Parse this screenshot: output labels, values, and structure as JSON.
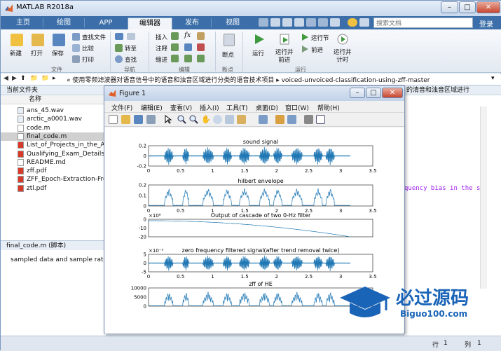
{
  "window": {
    "title": "MATLAB R2018a"
  },
  "tabs": [
    {
      "label": "主页"
    },
    {
      "label": "绘图"
    },
    {
      "label": "APP"
    },
    {
      "label": "编辑器"
    },
    {
      "label": "发布"
    },
    {
      "label": "视图"
    }
  ],
  "search": {
    "placeholder": "搜索文档"
  },
  "login": "登录",
  "ribbon": {
    "new": "新建",
    "open": "打开",
    "save": "保存",
    "find_file": "查找文件",
    "compare": "比较",
    "print": "打印",
    "goto": "转至",
    "find": "查找",
    "insert": "插入",
    "comment": "注释",
    "indent": "缩进",
    "breakpoint": "断点",
    "run": "运行",
    "run_advance": "运行并\n前进",
    "run_section": "运行节",
    "advance": "前进",
    "run_time": "运行并\n计时",
    "groups": {
      "file": "文件",
      "nav": "导航",
      "edit": "编辑",
      "breakpoints": "断点",
      "run": "运行"
    }
  },
  "address": {
    "path": "« 使用零频滤波器对语音信号中的语音和浊音区域进行分类的语音技术项目 ▸ voiced-unvoiced-classification-using-zff-master"
  },
  "current_folder": {
    "title": "当前文件夹",
    "column_name": "名称",
    "files": [
      {
        "name": "ans_45.wav",
        "type": "wav"
      },
      {
        "name": "arctic_a0001.wav",
        "type": "wav"
      },
      {
        "name": "code.m",
        "type": "m"
      },
      {
        "name": "final_code.m",
        "type": "m",
        "selected": true
      },
      {
        "name": "List_of_Projects_in_the_Are",
        "type": "pdf"
      },
      {
        "name": "Qualifying_Exam_Details.pdf",
        "type": "pdf"
      },
      {
        "name": "README.md",
        "type": "md"
      },
      {
        "name": "zff.pdf",
        "type": "pdf"
      },
      {
        "name": "ZFF_Epoch-Extraction-Fro",
        "type": "pdf"
      },
      {
        "name": "ztl.pdf",
        "type": "pdf"
      }
    ]
  },
  "details": {
    "file_label": "final_code.m  (脚本)",
    "text": "sampled data and sample rate"
  },
  "editor": {
    "header_text": "的清音和浊音区域进行",
    "visible_line": "quency bias in the si"
  },
  "status": {
    "row_label": "行",
    "row": "1",
    "col_label": "列",
    "col": "1"
  },
  "figure": {
    "title": "Figure 1",
    "menu": [
      "文件(F)",
      "编辑(E)",
      "查看(V)",
      "插入(I)",
      "工具(T)",
      "桌面(D)",
      "窗口(W)",
      "帮助(H)"
    ],
    "plots": [
      {
        "title": "sound signal",
        "yticks": [
          "0.2",
          "0",
          "-0.2"
        ],
        "xticks": [
          "0",
          "0.5",
          "1",
          "1.5",
          "2",
          "2.5",
          "3",
          "3.5"
        ]
      },
      {
        "title": "hilbert envelope",
        "yticks": [
          "0.2",
          "0.1",
          "0"
        ],
        "xticks": [
          "0",
          "0.5",
          "1",
          "1.5",
          "2",
          "2.5",
          "3",
          "3.5"
        ]
      },
      {
        "title": "Output of cascade of two 0-Hz filter",
        "exponent": "×10⁸",
        "yticks": [
          "0",
          "-10",
          "-20"
        ],
        "xticks": []
      },
      {
        "title": "zero frequency filtered signal(after trend removal twice)",
        "exponent": "×10⁻³",
        "yticks": [
          "5",
          "0",
          "-5"
        ],
        "xticks": [
          "0",
          "0.5",
          "1",
          "1.5",
          "2",
          "2.5",
          "3",
          "3.5"
        ]
      },
      {
        "title": "zff of HE",
        "yticks": [
          "10000",
          "5000",
          "0"
        ],
        "xticks": []
      }
    ]
  },
  "watermark": {
    "brand": "必过源码",
    "url": "Biguo100.com"
  },
  "colors": {
    "accent": "#3c6fa9",
    "plot_line": "#1f77b4"
  }
}
